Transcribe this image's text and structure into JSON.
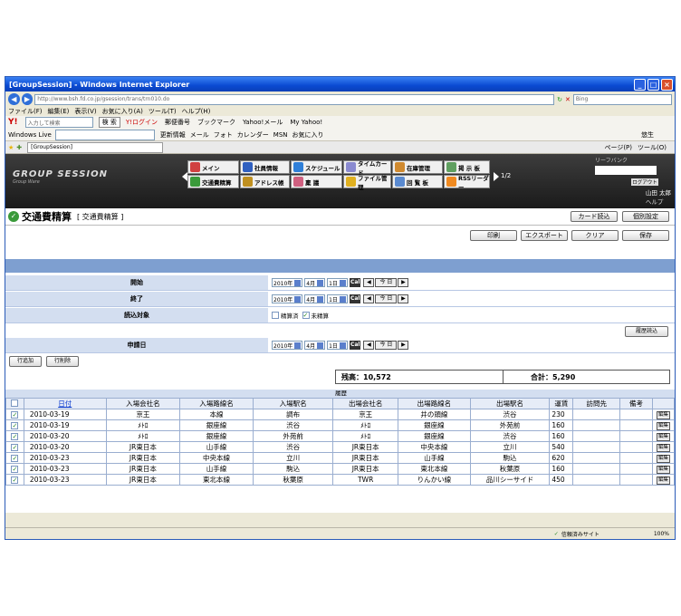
{
  "window": {
    "title": "[GroupSession] - Windows Internet Explorer"
  },
  "browser": {
    "address": "http://www.bsh.fd.co.jp/gsession/trans/trn010.do",
    "search_placeholder": "Bing",
    "menus": [
      "ファイル(F)",
      "編集(E)",
      "表示(V)",
      "お気に入り(A)",
      "ツール(T)",
      "ヘルプ(H)"
    ],
    "yahoo_search_placeholder": "入力して検索",
    "yahoo_search_btn": "検 索",
    "yahoo_items": [
      "Y!ログイン",
      "郵便番号",
      "ブックマーク",
      "Yahoo!メール",
      "My Yahoo!"
    ],
    "live_label": "Windows Live",
    "live_items": [
      "更新情報",
      "メール",
      "フォト",
      "カレンダー",
      "MSN",
      "お気に入り"
    ],
    "live_user": "悠生",
    "tab_label": "[GroupSession]",
    "cmd_items": [
      "ページ(P)",
      "ツール(O)"
    ]
  },
  "gs": {
    "logo": "GROUP SESSION",
    "logo_sub": "Group Ware",
    "apps": [
      "メイン",
      "社員情報",
      "スケジュール",
      "タイムカード",
      "在庫管理",
      "掲 示 板",
      "交通費精算",
      "アドレス帳",
      "稟 議",
      "ファイル管理",
      "回 覧 板",
      "RSSリーダー"
    ],
    "pager": "1/2",
    "search_label": "リーフバンク",
    "logout": "ログアウト",
    "user": "山田 太郎",
    "help": "ヘルプ"
  },
  "page": {
    "title": "交通費精算",
    "subtitle": "[ 交通費精算 ]",
    "card_read": "カード読込",
    "personal_settings": "個別設定",
    "print": "印刷",
    "export": "エクスポート",
    "clear": "クリア",
    "save": "保存"
  },
  "form": {
    "start_label": "開始",
    "end_label": "終了",
    "target_label": "読込対象",
    "apply_label": "申請日",
    "year": "2010年",
    "month": "4月",
    "day": "1日",
    "cal": "Cal",
    "today": "今 日",
    "opt_settled": "精算済",
    "opt_unsettled": "未精算",
    "history_read": "履歴読込",
    "add_row": "行追加",
    "del_row": "行削除"
  },
  "totals": {
    "balance": "残高：10,572",
    "total": "合計：5,290"
  },
  "history": {
    "caption": "履歴",
    "headers": [
      "日付",
      "入場会社名",
      "入場路線名",
      "入場駅名",
      "出場会社名",
      "出場路線名",
      "出場駅名",
      "運賃",
      "訪問先",
      "備考"
    ],
    "edit": "編集",
    "rows": [
      [
        "2010-03-19",
        "京王",
        "本線",
        "調布",
        "京王",
        "井の頭線",
        "渋谷",
        "230",
        "",
        ""
      ],
      [
        "2010-03-19",
        "ﾒﾄﾛ",
        "銀座線",
        "渋谷",
        "ﾒﾄﾛ",
        "銀座線",
        "外苑前",
        "160",
        "",
        ""
      ],
      [
        "2010-03-20",
        "ﾒﾄﾛ",
        "銀座線",
        "外苑前",
        "ﾒﾄﾛ",
        "銀座線",
        "渋谷",
        "160",
        "",
        ""
      ],
      [
        "2010-03-20",
        "JR東日本",
        "山手線",
        "渋谷",
        "JR東日本",
        "中央本線",
        "立川",
        "540",
        "",
        ""
      ],
      [
        "2010-03-23",
        "JR東日本",
        "中央本線",
        "立川",
        "JR東日本",
        "山手線",
        "駒込",
        "620",
        "",
        ""
      ],
      [
        "2010-03-23",
        "JR東日本",
        "山手線",
        "駒込",
        "JR東日本",
        "東北本線",
        "秋葉原",
        "160",
        "",
        ""
      ],
      [
        "2010-03-23",
        "JR東日本",
        "東北本線",
        "秋葉原",
        "TWR",
        "りんかい線",
        "品川シーサイド",
        "450",
        "",
        ""
      ]
    ]
  },
  "status": {
    "trusted": "信頼済みサイト",
    "zoom": "100%"
  }
}
